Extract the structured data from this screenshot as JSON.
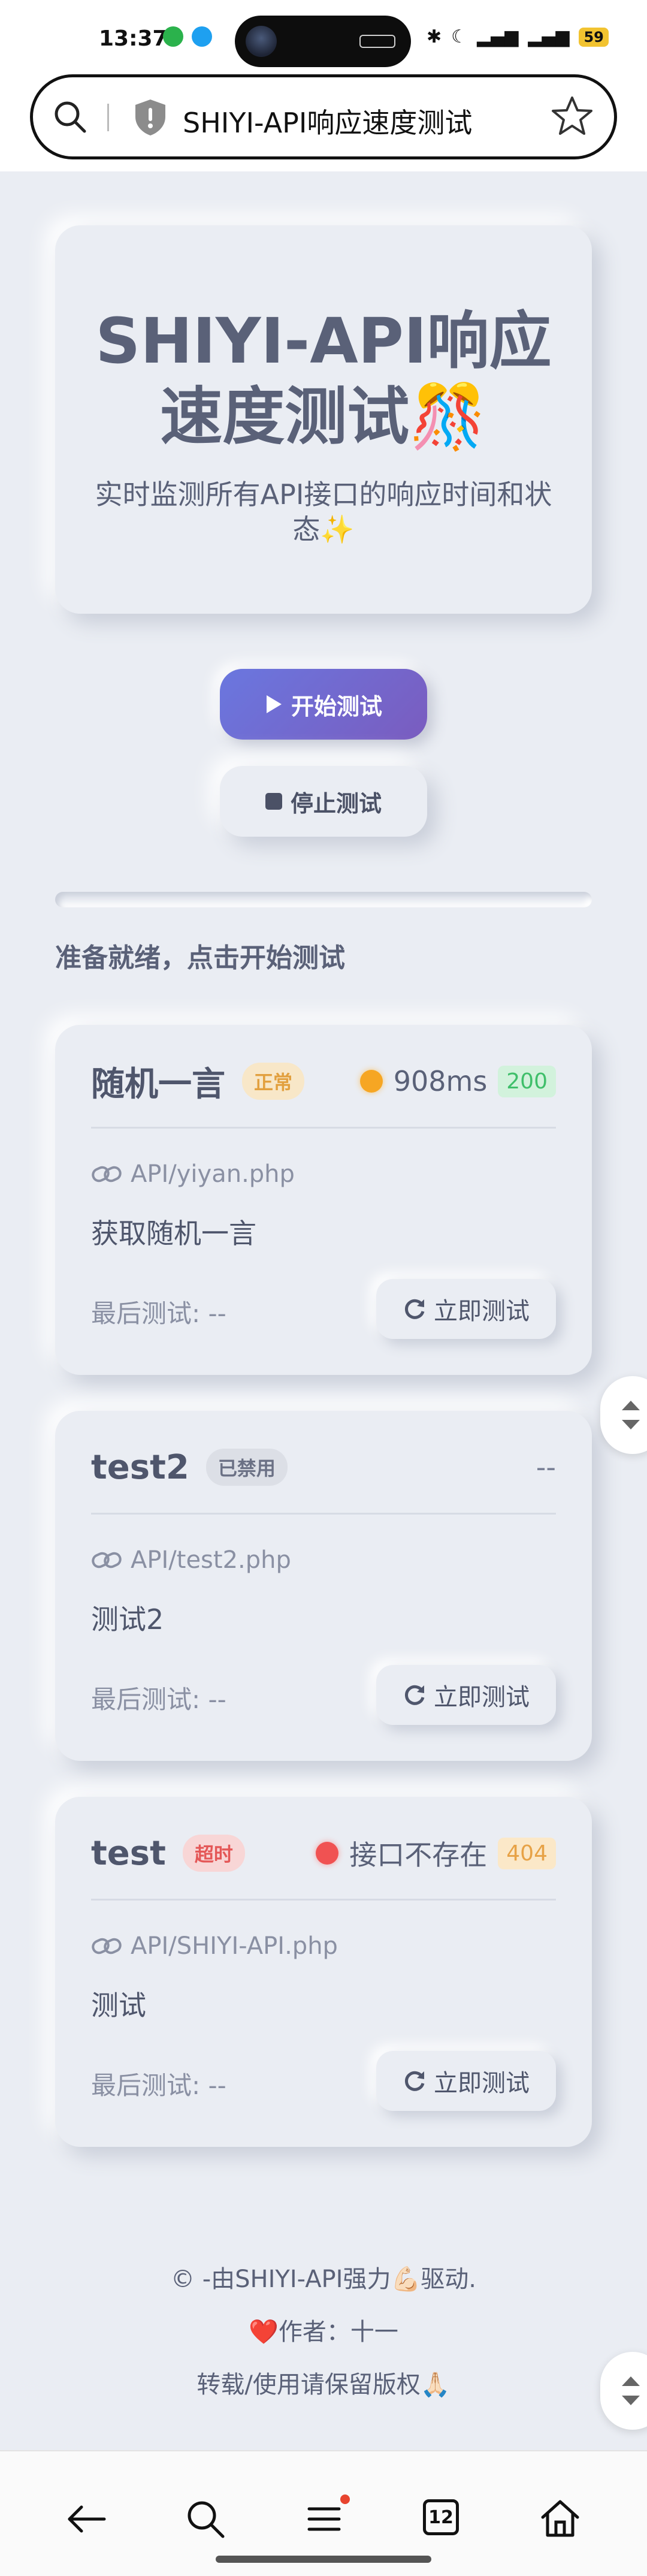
{
  "status_bar": {
    "time": "13:37",
    "battery": "59",
    "signal_icons": [
      "bluetooth-icon",
      "moon-icon",
      "signal-icon",
      "signal-icon"
    ]
  },
  "url_bar": {
    "text": "SHIYI-API响应速度测试"
  },
  "header": {
    "title": "SHIYI-API响应速度测试🎊",
    "subtitle": "实时监测所有API接口的响应时间和状态✨"
  },
  "controls": {
    "start_label": "开始测试",
    "stop_label": "停止测试",
    "progress": 0.0,
    "status": "准备就绪，点击开始测试"
  },
  "apis": [
    {
      "name": "随机一言",
      "tag": "正常",
      "latency": "908ms",
      "code": "200",
      "path": "API/yiyan.php",
      "description": "获取随机一言",
      "last_test_label": "最后测试:",
      "last_test_value": "--",
      "test_button": "立即测试"
    },
    {
      "name": "test2",
      "tag": "已禁用",
      "latency": "--",
      "code": "",
      "path": "API/test2.php",
      "description": "测试2",
      "last_test_label": "最后测试:",
      "last_test_value": "--",
      "test_button": "立即测试"
    },
    {
      "name": "test",
      "tag": "超时",
      "latency": "接口不存在",
      "code": "404",
      "path": "API/SHIYI-API.php",
      "description": "测试",
      "last_test_label": "最后测试:",
      "last_test_value": "--",
      "test_button": "立即测试"
    }
  ],
  "footer": {
    "line1": "© -由SHIYI-API强力💪🏻驱动.",
    "line2": "❤️作者：十一",
    "line3": "转载/使用请保留版权🙏🏻"
  },
  "bottom_nav": {
    "tabs_count": "12"
  },
  "colors": {
    "background": "#eaedf3",
    "accent_start": "#6a77df",
    "accent_end": "#7a5cbf",
    "ok": "#3fbf6a",
    "warn": "#f6a623",
    "error": "#f05252"
  }
}
